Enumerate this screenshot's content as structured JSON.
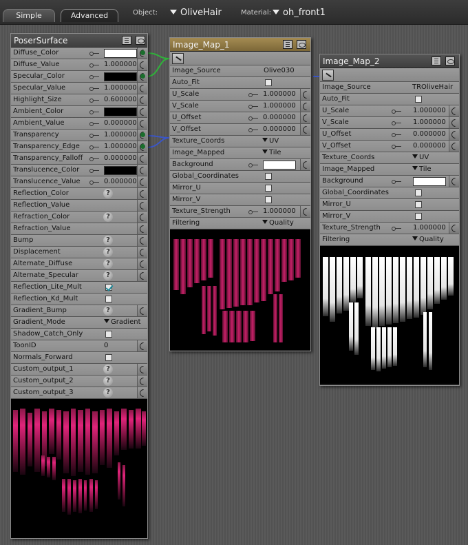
{
  "tabs": [
    "Simple",
    "Advanced"
  ],
  "object": {
    "label": "Object:",
    "value": "OliveHair"
  },
  "material": {
    "label": "Material:",
    "value": "oh_front1"
  },
  "poser_surface": {
    "title": "PoserSurface",
    "rows": [
      {
        "label": "Diffuse_Color",
        "kind": "color",
        "color": "#ffffff",
        "pin": "on"
      },
      {
        "label": "Diffuse_Value",
        "kind": "num",
        "value": "1.000000",
        "pin": "plain"
      },
      {
        "label": "Specular_Color",
        "kind": "color",
        "color": "#000000",
        "pin": "on"
      },
      {
        "label": "Specular_Value",
        "kind": "num",
        "value": "1.000000",
        "pin": "plain"
      },
      {
        "label": "Highlight_Size",
        "kind": "num",
        "value": "0.600000",
        "pin": "plain"
      },
      {
        "label": "Ambient_Color",
        "kind": "color",
        "color": "#000000",
        "pin": "plain"
      },
      {
        "label": "Ambient_Value",
        "kind": "num",
        "value": "0.000000",
        "pin": "plain"
      },
      {
        "label": "Transparency",
        "kind": "num",
        "value": "1.000000",
        "pin": "on"
      },
      {
        "label": "Transparency_Edge",
        "kind": "num",
        "value": "1.000000",
        "pin": "on"
      },
      {
        "label": "Transparency_Falloff",
        "kind": "num",
        "value": "0.000000",
        "pin": "plain"
      },
      {
        "label": "Translucence_Color",
        "kind": "color",
        "color": "#000000",
        "pin": "plain"
      },
      {
        "label": "Translucence_Value",
        "kind": "num",
        "value": "0.000000",
        "pin": "plain"
      },
      {
        "label": "Reflection_Color",
        "kind": "q",
        "pin": "plain"
      },
      {
        "label": "Reflection_Value",
        "kind": "none",
        "pin": "plain"
      },
      {
        "label": "Refraction_Color",
        "kind": "q",
        "pin": "plain"
      },
      {
        "label": "Refraction_Value",
        "kind": "none",
        "pin": "plain"
      },
      {
        "label": "Bump",
        "kind": "q",
        "pin": "plain"
      },
      {
        "label": "Displacement",
        "kind": "q",
        "pin": "plain"
      },
      {
        "label": "Alternate_Diffuse",
        "kind": "q",
        "pin": "plain"
      },
      {
        "label": "Alternate_Specular",
        "kind": "q",
        "pin": "plain"
      },
      {
        "label": "Reflection_Lite_Mult",
        "kind": "check",
        "checked": true,
        "pin": "none"
      },
      {
        "label": "Reflection_Kd_Mult",
        "kind": "check",
        "checked": false,
        "pin": "none"
      },
      {
        "label": "Gradient_Bump",
        "kind": "q",
        "pin": "plain"
      },
      {
        "label": "Gradient_Mode",
        "kind": "dd",
        "value": "Gradient B",
        "pin": "none"
      },
      {
        "label": "Shadow_Catch_Only",
        "kind": "check",
        "checked": false,
        "pin": "none"
      },
      {
        "label": "ToonID",
        "kind": "text",
        "value": "0",
        "pin": "plain"
      },
      {
        "label": "Normals_Forward",
        "kind": "check",
        "checked": false,
        "pin": "none"
      },
      {
        "label": "Custom_output_1",
        "kind": "q",
        "pin": "plain"
      },
      {
        "label": "Custom_output_2",
        "kind": "q",
        "pin": "plain"
      },
      {
        "label": "Custom_output_3",
        "kind": "q",
        "pin": "plain"
      }
    ]
  },
  "image_map_1": {
    "title": "Image_Map_1",
    "rows": [
      {
        "label": "Image_Source",
        "kind": "text",
        "value": "Olive030",
        "pin": "none"
      },
      {
        "label": "Auto_Fit",
        "kind": "check",
        "checked": false,
        "pin": "none"
      },
      {
        "label": "U_Scale",
        "kind": "num",
        "value": "1.000000",
        "pin": "plain"
      },
      {
        "label": "V_Scale",
        "kind": "num",
        "value": "1.000000",
        "pin": "plain"
      },
      {
        "label": "U_Offset",
        "kind": "num",
        "value": "0.000000",
        "pin": "plain"
      },
      {
        "label": "V_Offset",
        "kind": "num",
        "value": "0.000000",
        "pin": "plain"
      },
      {
        "label": "Texture_Coords",
        "kind": "dd",
        "value": "UV",
        "pin": "none"
      },
      {
        "label": "Image_Mapped",
        "kind": "dd",
        "value": "Tile",
        "pin": "none"
      },
      {
        "label": "Background",
        "kind": "color",
        "color": "#ffffff",
        "pin": "plain"
      },
      {
        "label": "Global_Coordinates",
        "kind": "check",
        "checked": false,
        "pin": "none"
      },
      {
        "label": "Mirror_U",
        "kind": "check",
        "checked": false,
        "pin": "none"
      },
      {
        "label": "Mirror_V",
        "kind": "check",
        "checked": false,
        "pin": "none"
      },
      {
        "label": "Texture_Strength",
        "kind": "num",
        "value": "1.000000",
        "pin": "plain"
      },
      {
        "label": "Filtering",
        "kind": "dd",
        "value": "Quality",
        "pin": "none"
      }
    ]
  },
  "image_map_2": {
    "title": "Image_Map_2",
    "rows": [
      {
        "label": "Image_Source",
        "kind": "text",
        "value": "TROliveHair",
        "pin": "none"
      },
      {
        "label": "Auto_Fit",
        "kind": "check",
        "checked": false,
        "pin": "none"
      },
      {
        "label": "U_Scale",
        "kind": "num",
        "value": "1.000000",
        "pin": "plain"
      },
      {
        "label": "V_Scale",
        "kind": "num",
        "value": "1.000000",
        "pin": "plain"
      },
      {
        "label": "U_Offset",
        "kind": "num",
        "value": "0.000000",
        "pin": "plain"
      },
      {
        "label": "V_Offset",
        "kind": "num",
        "value": "0.000000",
        "pin": "plain"
      },
      {
        "label": "Texture_Coords",
        "kind": "dd",
        "value": "UV",
        "pin": "none"
      },
      {
        "label": "Image_Mapped",
        "kind": "dd",
        "value": "Tile",
        "pin": "none"
      },
      {
        "label": "Background",
        "kind": "color",
        "color": "#ffffff",
        "pin": "plain"
      },
      {
        "label": "Global_Coordinates",
        "kind": "check",
        "checked": false,
        "pin": "none"
      },
      {
        "label": "Mirror_U",
        "kind": "check",
        "checked": false,
        "pin": "none"
      },
      {
        "label": "Mirror_V",
        "kind": "check",
        "checked": false,
        "pin": "none"
      },
      {
        "label": "Texture_Strength",
        "kind": "num",
        "value": "1.000000",
        "pin": "plain"
      },
      {
        "label": "Filtering",
        "kind": "dd",
        "value": "Quality",
        "pin": "none"
      }
    ]
  },
  "colors": {
    "accent_selected": "#8f7a46",
    "wire_green": "#2fb33a",
    "wire_blue": "#3b56c8",
    "hair_pink": "#d0206e"
  }
}
